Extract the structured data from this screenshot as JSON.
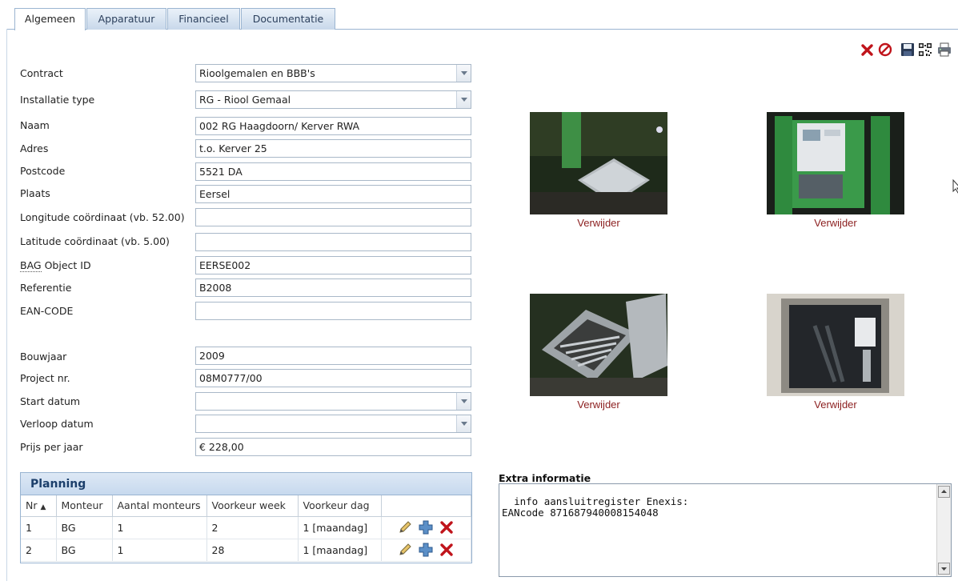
{
  "tabs": [
    {
      "label": "Algemeen",
      "active": true
    },
    {
      "label": "Apparatuur",
      "active": false
    },
    {
      "label": "Financieel",
      "active": false
    },
    {
      "label": "Documentatie",
      "active": false
    }
  ],
  "toolbar": {
    "icons": [
      "delete-icon",
      "cancel-icon",
      "save-icon",
      "qr-code-icon",
      "print-icon"
    ]
  },
  "form": {
    "contract": {
      "label": "Contract",
      "value": "Rioolgemalen en BBB's"
    },
    "installatie_type": {
      "label": "Installatie type",
      "value": "RG - Riool Gemaal"
    },
    "naam": {
      "label": "Naam",
      "value": "002 RG Haagdoorn/ Kerver RWA"
    },
    "adres": {
      "label": "Adres",
      "value": "t.o. Kerver 25"
    },
    "postcode": {
      "label": "Postcode",
      "value": "5521 DA"
    },
    "plaats": {
      "label": "Plaats",
      "value": "Eersel"
    },
    "longitude": {
      "label": "Longitude coördinaat (vb. 52.00)",
      "value": ""
    },
    "latitude": {
      "label": "Latitude coördinaat (vb. 5.00)",
      "value": ""
    },
    "bag": {
      "label_abbr": "BAG",
      "label_rest": " Object ID",
      "value": "EERSE002"
    },
    "referentie": {
      "label": "Referentie",
      "value": "B2008"
    },
    "ean": {
      "label": "EAN-CODE",
      "value": ""
    },
    "bouwjaar": {
      "label": "Bouwjaar",
      "value": "2009"
    },
    "project": {
      "label": "Project nr.",
      "value": "08M0777/00"
    },
    "start_datum": {
      "label": "Start datum",
      "value": ""
    },
    "verloop_datum": {
      "label": "Verloop datum",
      "value": ""
    },
    "prijs": {
      "label": "Prijs per jaar",
      "value": "€ 228,00"
    }
  },
  "photos": {
    "remove_label": "Verwijder"
  },
  "planning": {
    "title": "Planning",
    "columns": [
      "Nr",
      "Monteur",
      "Aantal monteurs",
      "Voorkeur week",
      "Voorkeur dag",
      ""
    ],
    "rows": [
      [
        "1",
        "BG",
        "1",
        "2",
        "1 [maandag]"
      ],
      [
        "2",
        "BG",
        "1",
        "28",
        "1 [maandag]"
      ]
    ]
  },
  "extra": {
    "label": "Extra informatie",
    "text": "info aansluitregister Enexis:\nEANcode 871687940008154048"
  },
  "colors": {
    "accent": "#1c3f6b",
    "link_red": "#8b1e1e",
    "border": "#99b4d1"
  }
}
